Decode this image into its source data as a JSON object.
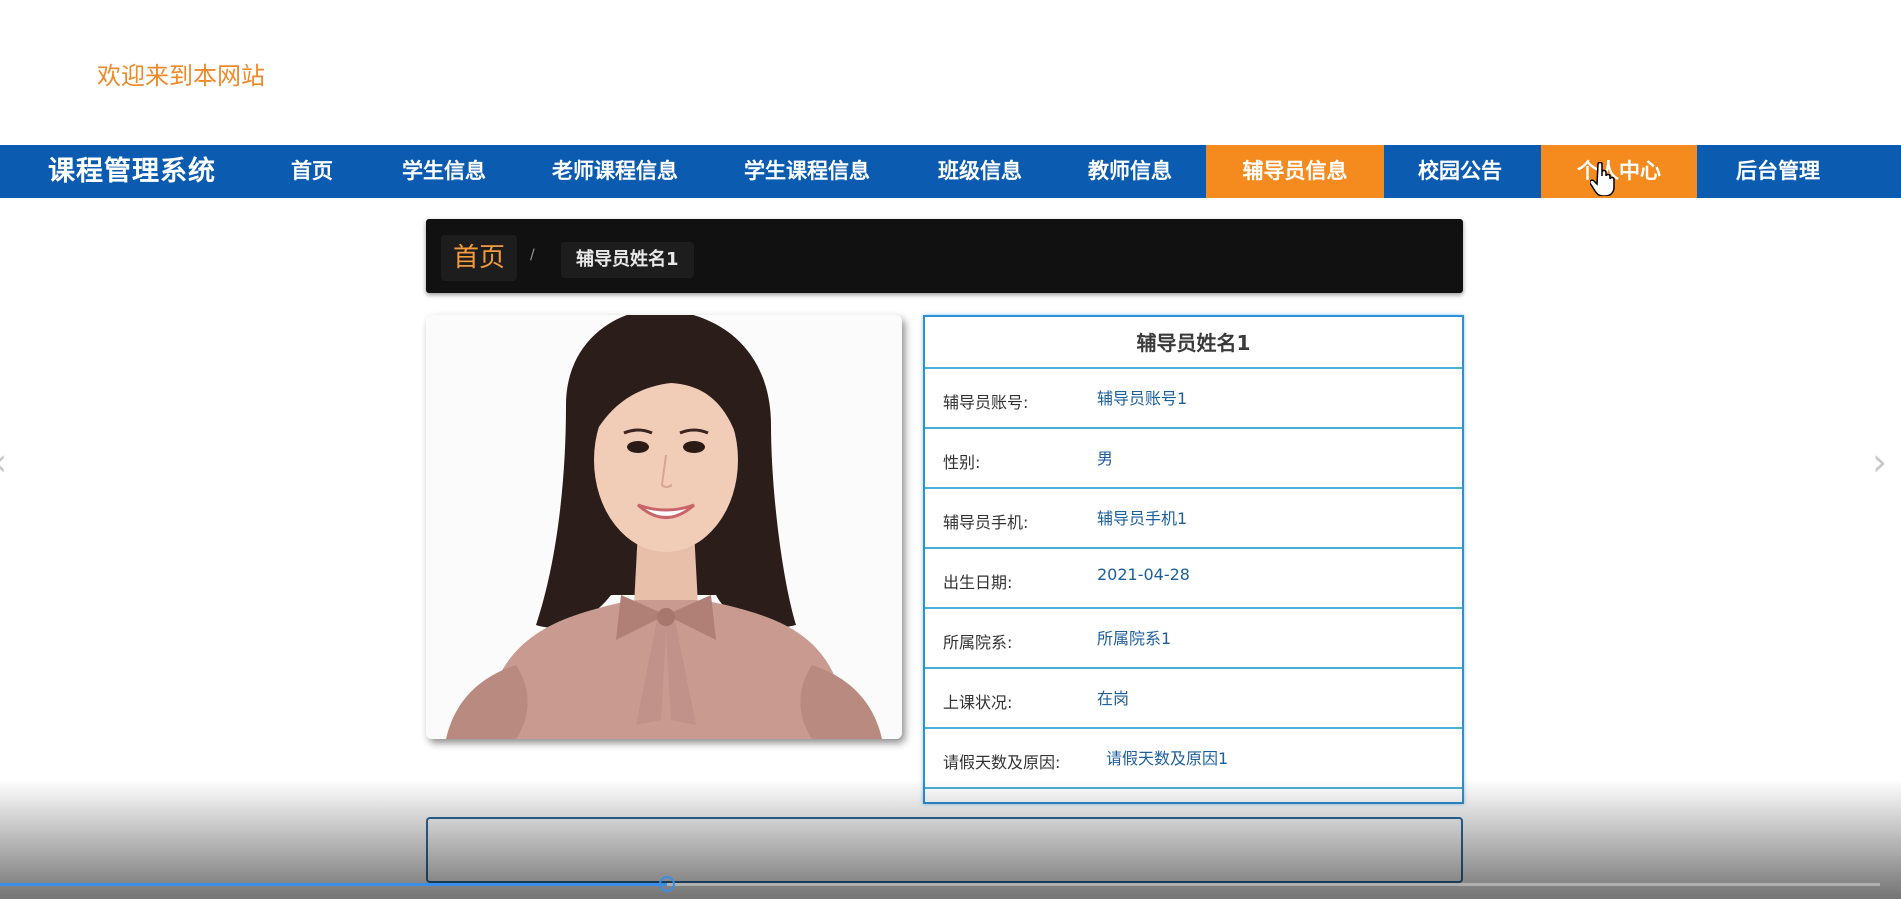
{
  "header": {
    "welcome": "欢迎来到本网站"
  },
  "nav": {
    "brand": "课程管理系统",
    "items": [
      {
        "label": "首页"
      },
      {
        "label": "学生信息"
      },
      {
        "label": "老师课程信息"
      },
      {
        "label": "学生课程信息"
      },
      {
        "label": "班级信息"
      },
      {
        "label": "教师信息"
      },
      {
        "label": "辅导员信息"
      },
      {
        "label": "校园公告"
      },
      {
        "label": "个人中心"
      },
      {
        "label": "后台管理"
      }
    ],
    "active_color": "#f58a1f",
    "bar_color": "#0b5bb0"
  },
  "breadcrumb": {
    "home": "首页",
    "separator": "/",
    "current": "辅导员姓名1"
  },
  "detail": {
    "title": "辅导员姓名1",
    "rows": [
      {
        "label": "辅导员账号:",
        "value": "辅导员账号1"
      },
      {
        "label": "性别:",
        "value": "男"
      },
      {
        "label": "辅导员手机:",
        "value": "辅导员手机1"
      },
      {
        "label": "出生日期:",
        "value": "2021-04-28"
      },
      {
        "label": "所属院系:",
        "value": "所属院系1"
      },
      {
        "label": "上课状况:",
        "value": "在岗"
      },
      {
        "label": "请假天数及原因:",
        "value": "请假天数及原因1"
      }
    ]
  },
  "video": {
    "progress_fraction": 0.355
  },
  "icons": {
    "left": "chevron-left-icon",
    "right": "chevron-right-icon",
    "cursor": "hand-cursor-icon"
  }
}
